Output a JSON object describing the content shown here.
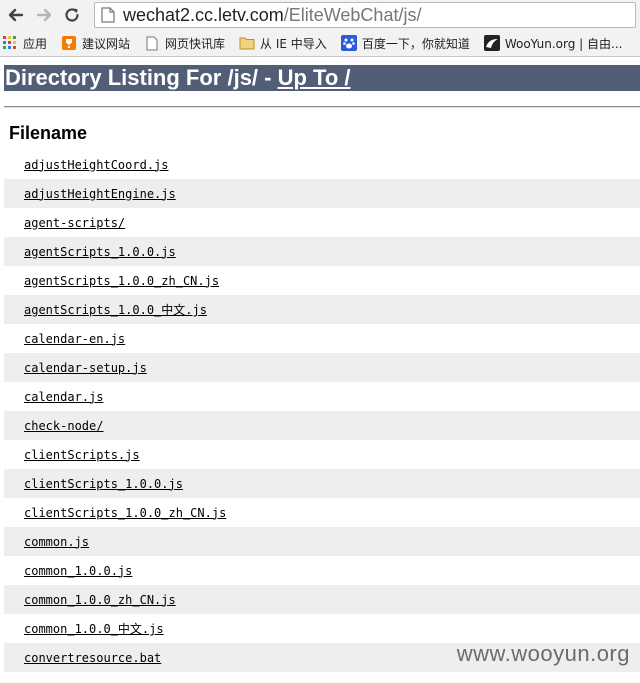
{
  "browser": {
    "url_host": "wechat2.cc.letv.com",
    "url_path": "/EliteWebChat/js/",
    "bookmarks": [
      {
        "label": "应用",
        "icon": "apps-grid-icon"
      },
      {
        "label": "建议网站",
        "icon": "suggested-sites-icon"
      },
      {
        "label": "网页快讯库",
        "icon": "page-icon"
      },
      {
        "label": "从 IE 中导入",
        "icon": "folder-icon"
      },
      {
        "label": "百度一下，你就知道",
        "icon": "baidu-paw-icon"
      },
      {
        "label": "WooYun.org | 自由...",
        "icon": "wooyun-icon"
      }
    ]
  },
  "page": {
    "heading_prefix": "Directory Listing For /js/ - ",
    "heading_link": "Up To /",
    "column_header": "Filename",
    "files": [
      "adjustHeightCoord.js",
      "adjustHeightEngine.js",
      "agent-scripts/",
      "agentScripts_1.0.0.js",
      "agentScripts_1.0.0_zh_CN.js",
      "agentScripts_1.0.0_中文.js",
      "calendar-en.js",
      "calendar-setup.js",
      "calendar.js",
      "check-node/",
      "clientScripts.js",
      "clientScripts_1.0.0.js",
      "clientScripts_1.0.0_zh_CN.js",
      "common.js",
      "common_1.0.0.js",
      "common_1.0.0_zh_CN.js",
      "common_1.0.0_中文.js",
      "convertresource.bat"
    ]
  },
  "watermark": "www.wooyun.org"
}
